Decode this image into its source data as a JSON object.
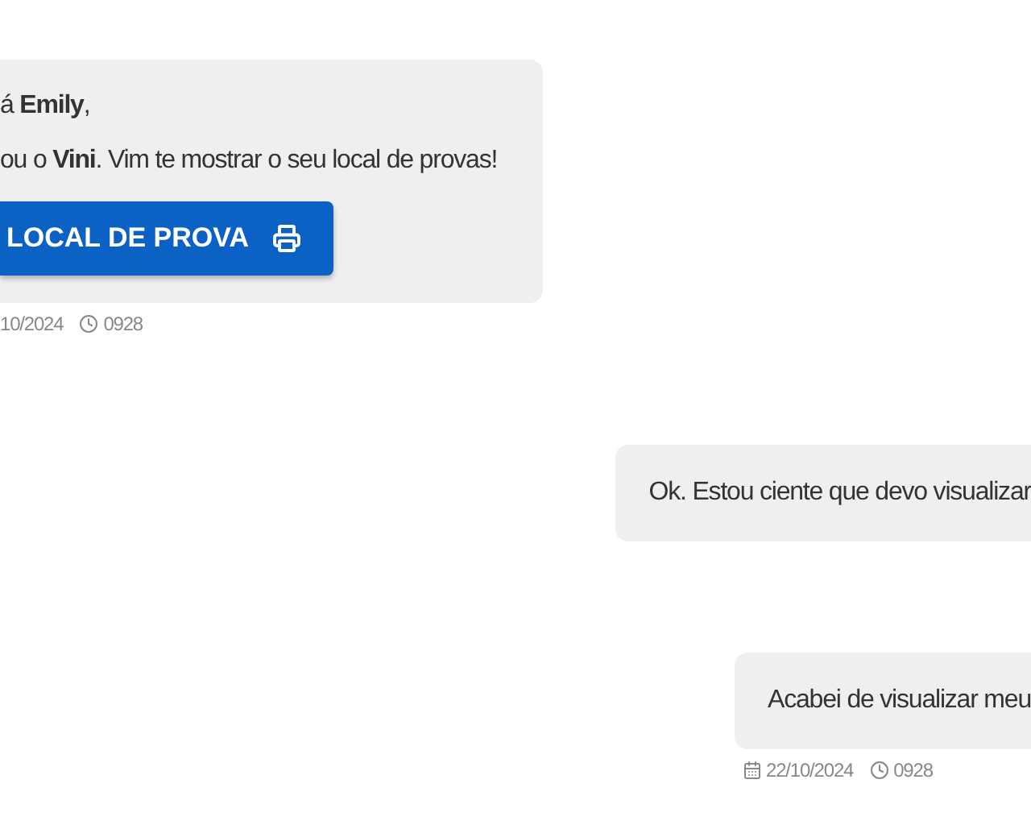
{
  "messages": [
    {
      "kind": "incoming",
      "lines": [
        "á **Emily**,",
        "ou o **Vini**. Vim te mostrar o seu local de provas!"
      ],
      "button": "LOCAL DE PROVA",
      "date": "10/2024",
      "time": "0928"
    },
    {
      "kind": "outgoing",
      "lines": [
        "Ok. Estou ciente que devo visualizar"
      ]
    },
    {
      "kind": "outgoing",
      "lines": [
        "Acabei de visualizar meu"
      ],
      "date": "22/10/2024",
      "time": "0928"
    }
  ]
}
